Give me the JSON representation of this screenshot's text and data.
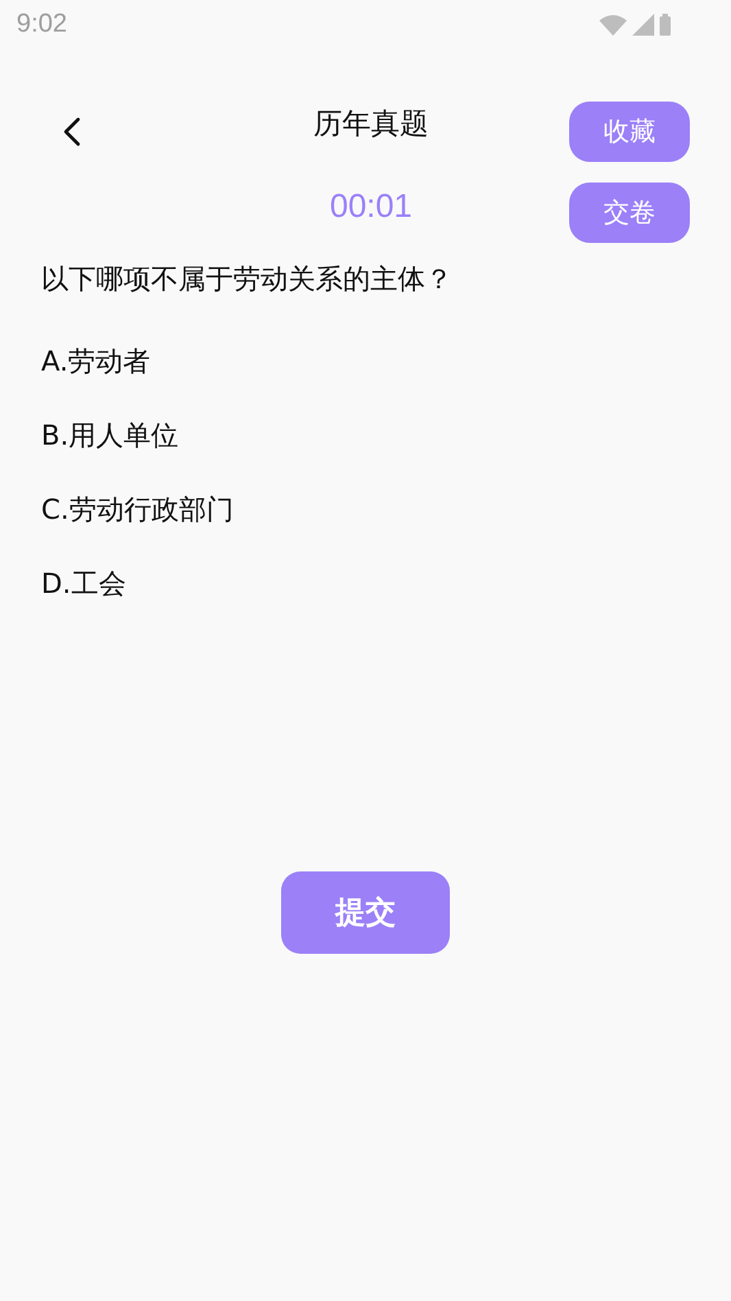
{
  "status_bar": {
    "time": "9:02"
  },
  "header": {
    "title": "历年真题",
    "favorite_button": "收藏",
    "submit_paper_button": "交卷",
    "timer": "00:01"
  },
  "question": {
    "text": "以下哪项不属于劳动关系的主体？",
    "options": [
      {
        "label": "A.劳动者"
      },
      {
        "label": "B.用人单位"
      },
      {
        "label": "C.劳动行政部门"
      },
      {
        "label": "D.工会"
      }
    ]
  },
  "submit_button": "提交"
}
